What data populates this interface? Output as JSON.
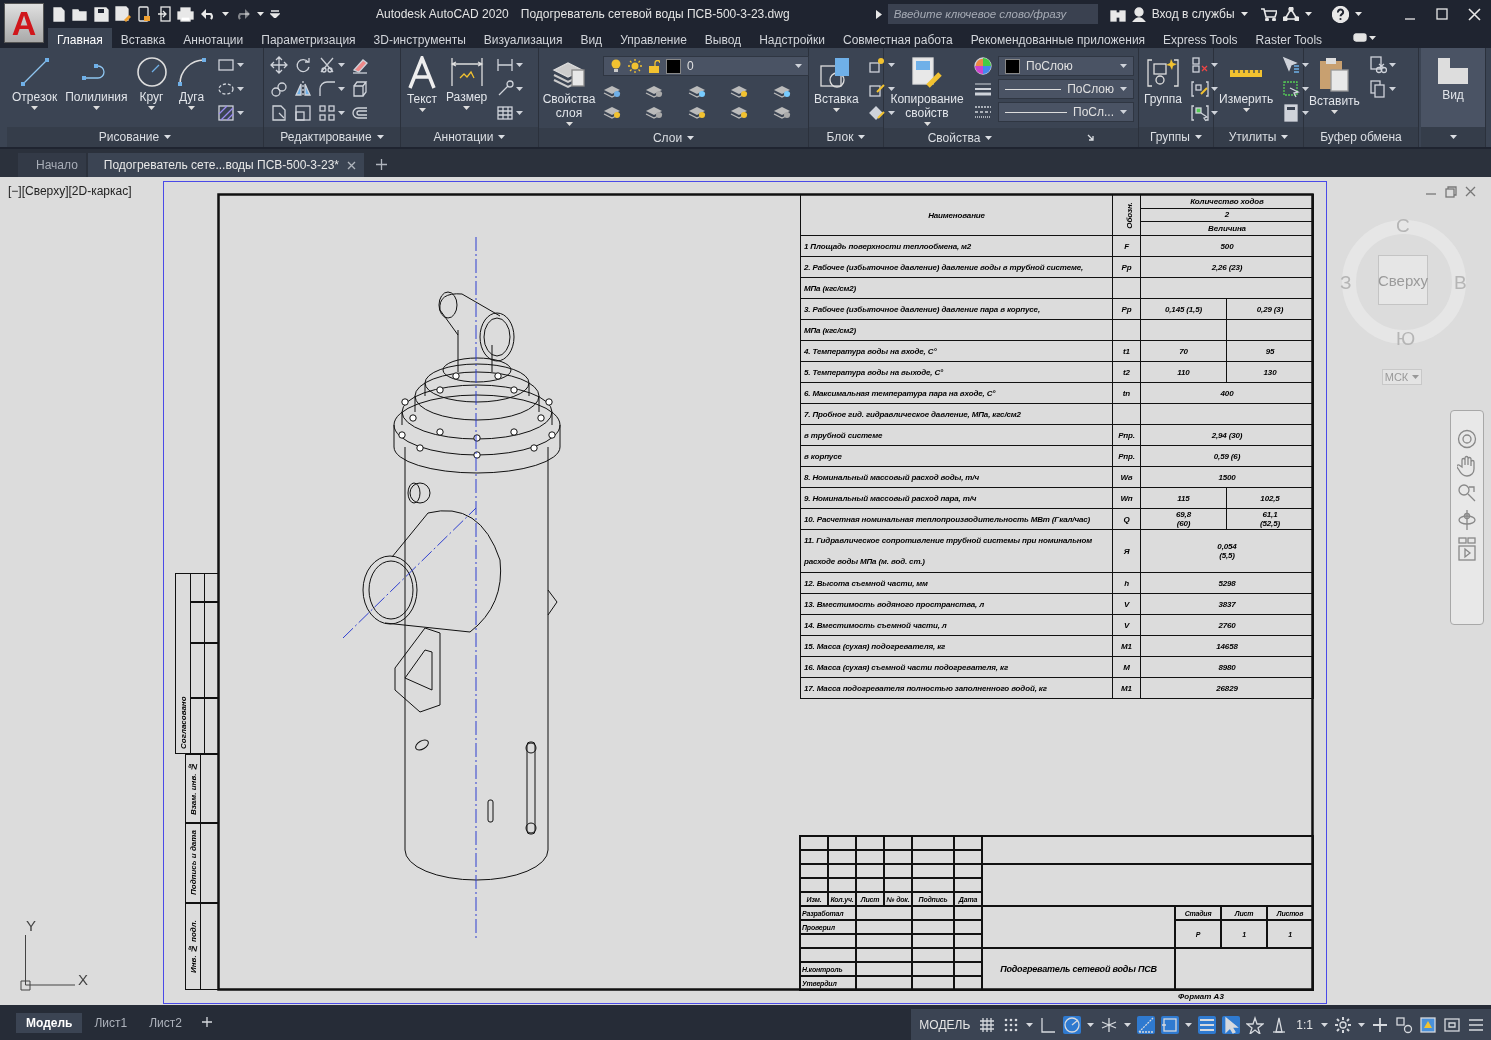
{
  "app": {
    "logo": "A"
  },
  "title_bar": {
    "app_name": "Autodesk AutoCAD 2020",
    "file_name": "Подогреватель сетевой воды ПСВ-500-3-23.dwg",
    "search": {
      "placeholder": "Введите ключевое слово/фразу"
    },
    "sign_in": "Вход в службы"
  },
  "menu_tabs": [
    {
      "label": "Главная",
      "selected": true
    },
    {
      "label": "Вставка",
      "selected": false
    },
    {
      "label": "Аннотации",
      "selected": false
    },
    {
      "label": "Параметризация",
      "selected": false
    },
    {
      "label": "3D-инструменты",
      "selected": false
    },
    {
      "label": "Визуализация",
      "selected": false
    },
    {
      "label": "Вид",
      "selected": false
    },
    {
      "label": "Управление",
      "selected": false
    },
    {
      "label": "Вывод",
      "selected": false
    },
    {
      "label": "Надстройки",
      "selected": false
    },
    {
      "label": "Совместная работа",
      "selected": false
    },
    {
      "label": "Рекомендованные приложения",
      "selected": false
    },
    {
      "label": "Express Tools",
      "selected": false
    },
    {
      "label": "Raster Tools",
      "selected": false
    }
  ],
  "ribbon": {
    "panels": [
      {
        "kind": "draw",
        "label": "Рисование",
        "buttons": [
          "Отрезок",
          "Полилиния",
          "Круг",
          "Дуга"
        ]
      },
      {
        "kind": "modify",
        "label": "Редактирование"
      },
      {
        "kind": "annotate",
        "label": "Аннотации",
        "buttons": [
          "Текст",
          "Размер"
        ]
      },
      {
        "kind": "layers",
        "label": "Слои",
        "buttons": [
          "Свойства слоя"
        ],
        "layer": "0"
      },
      {
        "kind": "block",
        "label": "Блок",
        "buttons": [
          "Вставка"
        ]
      },
      {
        "kind": "properties",
        "label": "Свойства",
        "buttons": [
          "Копирование свойств"
        ],
        "dropdowns": [
          "ПоСлою",
          "ПоСлою",
          "ПоСл..."
        ]
      },
      {
        "kind": "groups",
        "label": "Группы",
        "buttons": [
          "Группа"
        ]
      },
      {
        "kind": "utilities",
        "label": "Утилиты",
        "buttons": [
          "Измерить"
        ]
      },
      {
        "kind": "clipboard",
        "label": "Буфер обмена",
        "buttons": [
          "Вставить"
        ]
      },
      {
        "kind": "view",
        "buttons": [
          "Вид"
        ]
      }
    ]
  },
  "document_tabs": [
    {
      "label": "Начало",
      "selected": false
    },
    {
      "label": "Подогреватель сете...воды ПСВ-500-3-23*",
      "selected": true
    }
  ],
  "viewport": {
    "label": "[−][Сверху][2D-каркас]",
    "view_cube": {
      "north": "С",
      "east": "В",
      "south": "Ю",
      "west": "З",
      "face": "Сверху",
      "ucs": "МСК"
    },
    "ucs_icon": {
      "x": "X",
      "y": "Y"
    }
  },
  "drawing": {
    "spec_table": {
      "header": {
        "name": "Наименование",
        "symbol": "Обозн.",
        "group": "Количество ходов",
        "passes": "2",
        "value": "Величина"
      },
      "rows": [
        {
          "name": "1 Площадь поверхности теплообмена, м2",
          "symbol": "F",
          "values": [
            "500"
          ]
        },
        {
          "name": "2. Рабочее (избыточное давление) давление воды в трубной системе,",
          "symbol": "Рр",
          "values": [
            "2,26 (23)"
          ]
        },
        {
          "name": "МПа (кгс/см2)"
        },
        {
          "name": "3. Рабочее (избыточное давление) давление пара в корпусе,",
          "symbol": "Рр",
          "values": [
            "0,145 (1,5)",
            "0,29 (3)"
          ]
        },
        {
          "name": "МПа (кгс/см2)"
        },
        {
          "name": "4. Температура воды на входе, С°",
          "symbol": "t1",
          "values": [
            "70",
            "95"
          ]
        },
        {
          "name": "5. Температура воды на выходе, С°",
          "symbol": "t2",
          "values": [
            "110",
            "130"
          ]
        },
        {
          "name": "6. Максимальная температура пара на входе, С°",
          "symbol": "tn",
          "values": [
            "400"
          ]
        },
        {
          "name": "7. Пробное гид. гидравлическое давление, МПа, кгс/см2"
        },
        {
          "name": "в трубной системе",
          "symbol": "Рпр.",
          "values": [
            "2,94 (30)"
          ]
        },
        {
          "name": "в корпусе",
          "symbol": "Рпр.",
          "values": [
            "0,59 (6)"
          ]
        },
        {
          "name": "8. Номинальный массовый расход воды, т/ч",
          "symbol": "Wв",
          "values": [
            "1500"
          ]
        },
        {
          "name": "9. Номинальный массовый расход пара, т/ч",
          "symbol": "Wп",
          "values": [
            "115",
            "102,5"
          ]
        },
        {
          "name": "10. Расчетная номинальная теплопроизводительность МВт (Гкал/час)",
          "symbol": "Q",
          "values": [
            [
              "69,8",
              "(60)"
            ],
            [
              "61,1",
              "(52,5)"
            ]
          ]
        },
        {
          "name": "11. Гидравлическое сопротивление трубной системы при номинальном расходе воды МПа (м. вод. ст.)",
          "symbol": "Я",
          "values": [
            [
              "0,054",
              "(5,5)"
            ]
          ]
        },
        {
          "name": "12. Высота съемной части, мм",
          "symbol": "h",
          "values": [
            "5298"
          ]
        },
        {
          "name": "13. Вместимость водяного пространства, л",
          "symbol": "V",
          "values": [
            "3837"
          ]
        },
        {
          "name": "14. Вместимость съемной части, л",
          "symbol": "V",
          "values": [
            "2760"
          ]
        },
        {
          "name": "15. Масса (сухая) подогревателя, кг",
          "symbol": "М1",
          "values": [
            "14658"
          ]
        },
        {
          "name": "16. Масса (сухая) съемной части подогревателя, кг",
          "symbol": "М",
          "values": [
            "8980"
          ]
        },
        {
          "name": "17. Масса подогревателя полностью заполненного водой, кг",
          "symbol": "М1",
          "values": [
            "26829"
          ]
        }
      ]
    },
    "title_block": {
      "columns": [
        "Изм.",
        "Кол.уч.",
        "Лист",
        "№ док.",
        "Подпись",
        "Дата"
      ],
      "roles": [
        "Разработал",
        "Проверил",
        "Н.контроль",
        "Утвердил"
      ],
      "stage_headers": [
        "Стадия",
        "Лист",
        "Листов"
      ],
      "stage_values": [
        "Р",
        "1",
        "1"
      ],
      "title": "Подогреватель сетевой воды ПСВ"
    },
    "side_stamp": [
      "Согласовано",
      "Взам. инв. №",
      "Подпись и дата",
      "Инв. № подл."
    ],
    "format": "Формат А3"
  },
  "status_bar": {
    "layout_tabs": [
      {
        "label": "Модель",
        "selected": true
      },
      {
        "label": "Лист1",
        "selected": false
      },
      {
        "label": "Лист2",
        "selected": false
      }
    ],
    "space": "МОДЕЛЬ",
    "scale": "1:1"
  }
}
